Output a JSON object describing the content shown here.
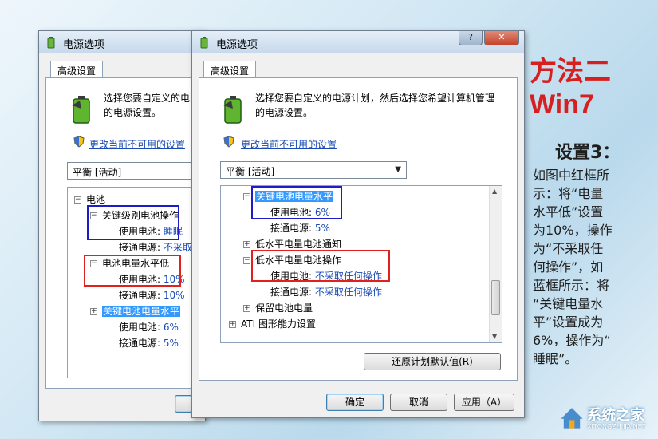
{
  "back_window": {
    "title": "电源选项",
    "tab": "高级设置",
    "description": "选择您要自定义的电源计划，然后选择您希望计算机管理的电源设置。",
    "description_line1": "选择您要自定义的电",
    "description_line2": "的电源设置。",
    "link": "更改当前不可用的设置",
    "plan": "平衡 [活动]",
    "tree": {
      "battery": "电池",
      "critical_action": "关键级别电池操作",
      "on_battery_label": "使用电池:",
      "on_battery_sleep": "睡眠",
      "plugged_in_label": "接通电源:",
      "plugged_in_noaction": "不采取",
      "low_level": "电池电量水平低",
      "on_battery_10": "10%",
      "plugged_in_10": "10%",
      "critical_level": "关键电池电量水平",
      "on_battery_6": "6%",
      "plugged_in_5": "5%"
    }
  },
  "front_window": {
    "title": "电源选项",
    "help_button": "?",
    "close_button": "✕",
    "tab": "高级设置",
    "description_line1": "选择您要自定义的电源计划，然后选择您希望计算机管理",
    "description_line2": "的电源设置。",
    "link": "更改当前不可用的设置",
    "plan": "平衡 [活动]",
    "tree": {
      "critical_level": "关键电池电量水平",
      "on_battery_label": "使用电池:",
      "on_battery_6": "6%",
      "plugged_in_label": "接通电源:",
      "plugged_in_5": "5%",
      "low_notify": "低水平电量电池通知",
      "low_action": "低水平电量电池操作",
      "on_battery_noaction": "不采取任何操作",
      "plugged_in_noaction": "不采取任何操作",
      "reserve_level": "保留电池电量",
      "ati": "ATI 图形能力设置"
    },
    "restore_button": "还原计划默认值(R)",
    "ok_button": "确定",
    "cancel_button": "取消",
    "apply_button": "应用（A）"
  },
  "side_panel": {
    "heading1": "方法二",
    "heading2": "Win7",
    "step_title": "设置3：",
    "lines": [
      "如图中红框所",
      "示：将“电量",
      "水平低”设置",
      "为10%，操作",
      "为“不采取任",
      "何操作”，如",
      "蓝框所示：将",
      "“关键电量水",
      "平”设置成为",
      "6%，操作为“",
      "睡眠”。"
    ]
  },
  "watermark": {
    "text": "系统之家",
    "sub": "XITONGZHIJIA.NET"
  },
  "colors": {
    "highlight_red": "#e0211d",
    "highlight_blue": "#1c1cc8",
    "link_blue": "#1a4bb4",
    "heading_red": "#d81f1f"
  }
}
